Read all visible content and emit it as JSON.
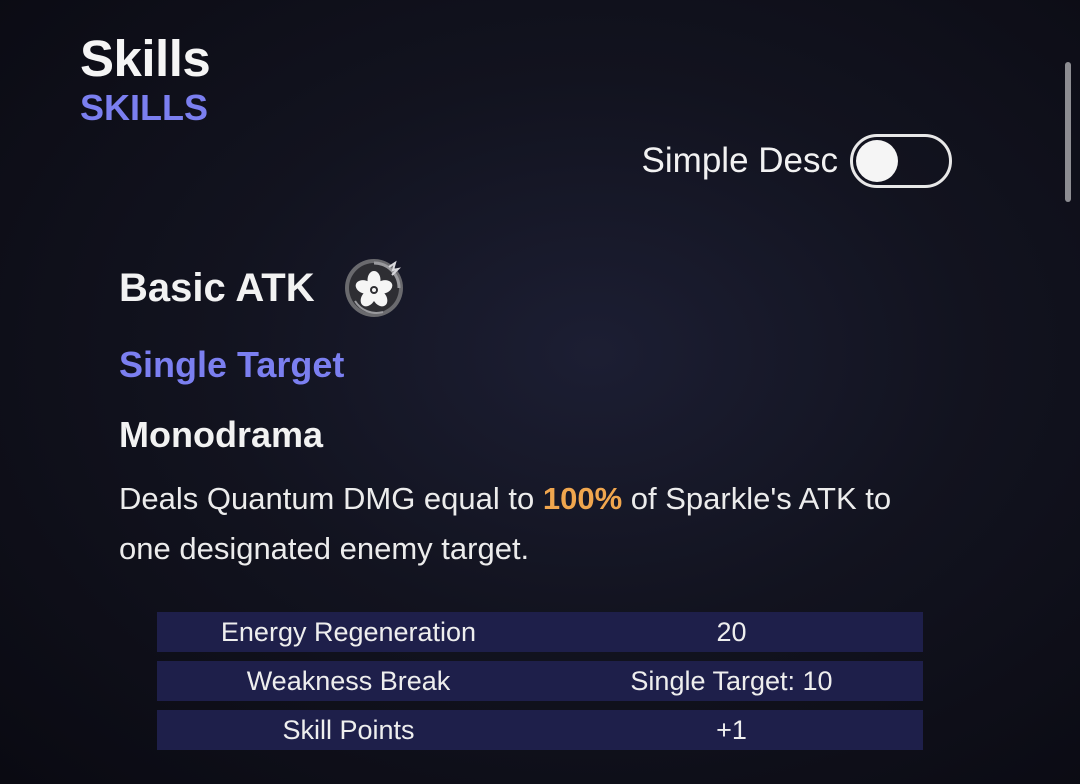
{
  "header": {
    "title": "Skills",
    "subtitle": "SKILLS"
  },
  "toggle": {
    "label": "Simple Desc",
    "state": "off"
  },
  "skill": {
    "type": "Basic ATK",
    "icon": "flower-emblem-icon",
    "target": "Single Target",
    "name": "Monodrama",
    "description": {
      "before": "Deals Quantum DMG equal to ",
      "highlight": "100%",
      "after": " of Sparkle's ATK to one designated enemy target."
    }
  },
  "stats": [
    {
      "label": "Energy Regeneration",
      "value": "20"
    },
    {
      "label": "Weakness Break",
      "value": "Single Target: 10"
    },
    {
      "label": "Skill Points",
      "value": "+1"
    }
  ],
  "colors": {
    "accent": "#7b7ff0",
    "highlight": "#f0a64e",
    "row_bg": "#1e1f4a"
  }
}
